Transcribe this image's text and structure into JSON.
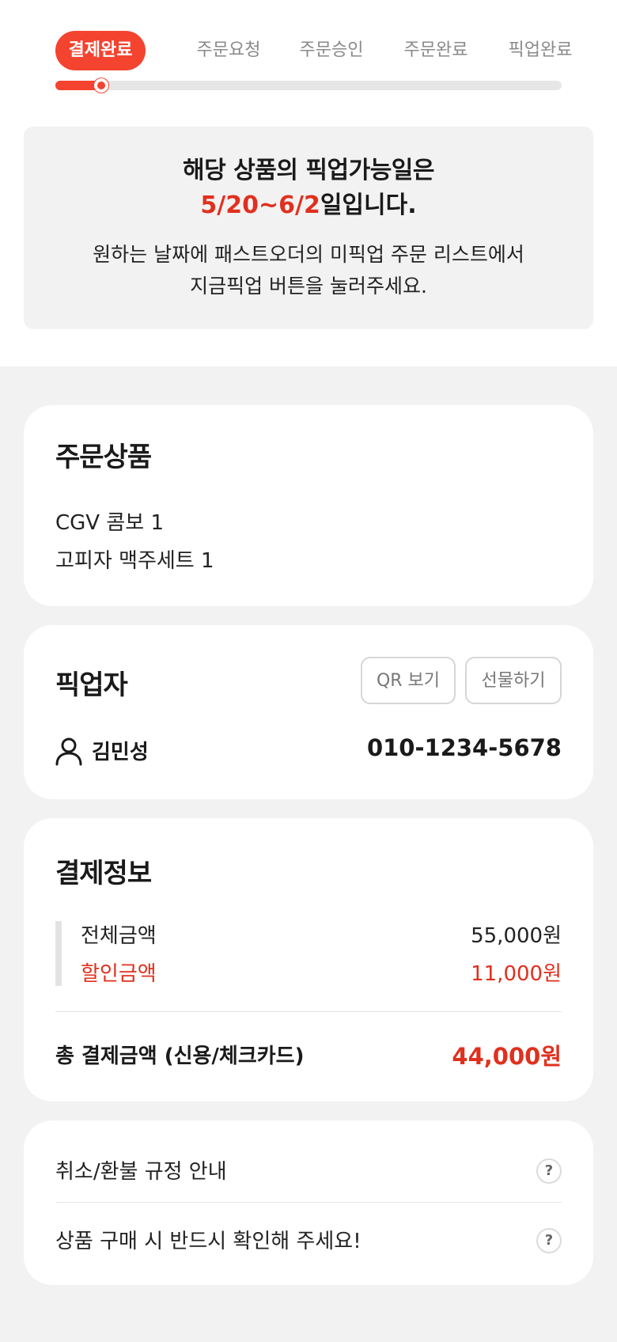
{
  "steps": [
    {
      "label": "결제완료",
      "active": true
    },
    {
      "label": "주문요청"
    },
    {
      "label": "주문승인"
    },
    {
      "label": "주문완료"
    },
    {
      "label": "픽업완료"
    }
  ],
  "progress": {
    "fraction": 0.09
  },
  "colors": {
    "accent": "#f4432f",
    "alert_text": "#e0301e"
  },
  "notice": {
    "title": "해당 상품의 픽업가능일은",
    "date_range": "5/20~6/2",
    "date_suffix": "일입니다.",
    "desc_line1": "원하는 날짜에 패스트오더의 미픽업 주문 리스트에서",
    "desc_line2": "지금픽업 버튼을 눌러주세요."
  },
  "order": {
    "title": "주문상품",
    "items": [
      "CGV 콤보 1",
      "고피자 맥주세트 1"
    ]
  },
  "picker": {
    "title": "픽업자",
    "qr_button": "QR 보기",
    "gift_button": "선물하기",
    "icon": "person-icon",
    "name": "김민성",
    "phone": "010-1234-5678"
  },
  "payment": {
    "title": "결제정보",
    "total_amount_label": "전체금액",
    "total_amount_value": "55,000원",
    "discount_label": "할인금액",
    "discount_value": "11,000원",
    "final_label": "총 결제금액 (신용/체크카드)",
    "final_value": "44,000원"
  },
  "info": {
    "refund_policy": "취소/환불 규정 안내",
    "purchase_notice": "상품 구매 시 반드시 확인해 주세요!",
    "help_glyph": "?"
  }
}
